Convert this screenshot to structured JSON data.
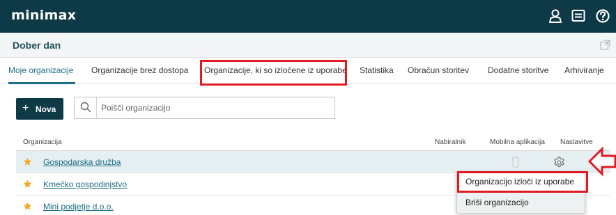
{
  "app": {
    "logo": "minimax"
  },
  "header": {
    "greeting": "Dober dan"
  },
  "tabs": [
    {
      "label": "Moje organizacije"
    },
    {
      "label": "Organizacije brez dostopa"
    },
    {
      "label": "Organizacije, ki so izločene iz uporabe"
    },
    {
      "label": "Statistika"
    },
    {
      "label": "Obračun storitev"
    },
    {
      "label": "Dodatne storitve"
    },
    {
      "label": "Arhiviranje"
    }
  ],
  "toolbar": {
    "new_label": "Nova",
    "search_placeholder": "Poišči organizacijo"
  },
  "table": {
    "columns": [
      "Organizacija",
      "Nabiralnik",
      "Mobilna aplikacija",
      "Nastavitve"
    ],
    "rows": [
      {
        "name": "Gospodarska družba"
      },
      {
        "name": "Kmečko gospodinjstvo"
      },
      {
        "name": "Mini podjetje d.o.o."
      }
    ]
  },
  "menu": {
    "items": [
      "Organizacijo izloči iz uporabe",
      "Briši organizacijo"
    ]
  },
  "colors": {
    "header": "#0e3a48",
    "accent": "#1d6e86",
    "highlight": "#e21b23",
    "star": "#f5a623"
  },
  "icons": [
    "user-icon",
    "messages-icon",
    "help-icon",
    "popout-icon",
    "plus-icon",
    "search-icon",
    "star-icon",
    "phone-icon",
    "gear-icon",
    "arrow-left-icon"
  ]
}
